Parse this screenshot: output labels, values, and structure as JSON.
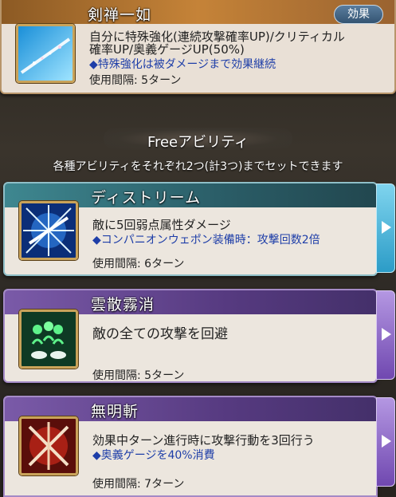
{
  "top_skill": {
    "title": "剣禅一如",
    "effect_button": "効果",
    "desc_line1": "自分に特殊強化(連続攻撃確率UP)/クリティカル",
    "desc_line2": "確率UP/奥義ゲージUP(50%)",
    "note": "◆特殊強化は被ダメージまで効果継続",
    "cooldown": "使用間隔: 5ターン"
  },
  "free_section": {
    "title": "Freeアビリティ",
    "subtitle": "各種アビリティをそれぞれ2つ(計3つ)までセットできます"
  },
  "abilities": [
    {
      "title": "ディストリーム",
      "desc": "敵に5回弱点属性ダメージ",
      "note": "◆コンパニオンウェポン装備時：攻撃回数2倍",
      "cooldown": "使用間隔: 6ターン",
      "theme": "teal"
    },
    {
      "title": "雲散霧消",
      "desc": "敵の全ての攻撃を回避",
      "note": "",
      "cooldown": "使用間隔: 5ターン",
      "theme": "purple"
    },
    {
      "title": "無明斬",
      "desc": "効果中ターン進行時に攻撃行動を3回行う",
      "note": "◆奥義ゲージを40%消費",
      "cooldown": "使用間隔: 7ターン",
      "theme": "purple"
    }
  ],
  "colors": {
    "teal_header": "#2f6f78",
    "purple_header": "#5c3f86",
    "orange_header": "#a9692a",
    "card_bg": "#efe8df"
  }
}
